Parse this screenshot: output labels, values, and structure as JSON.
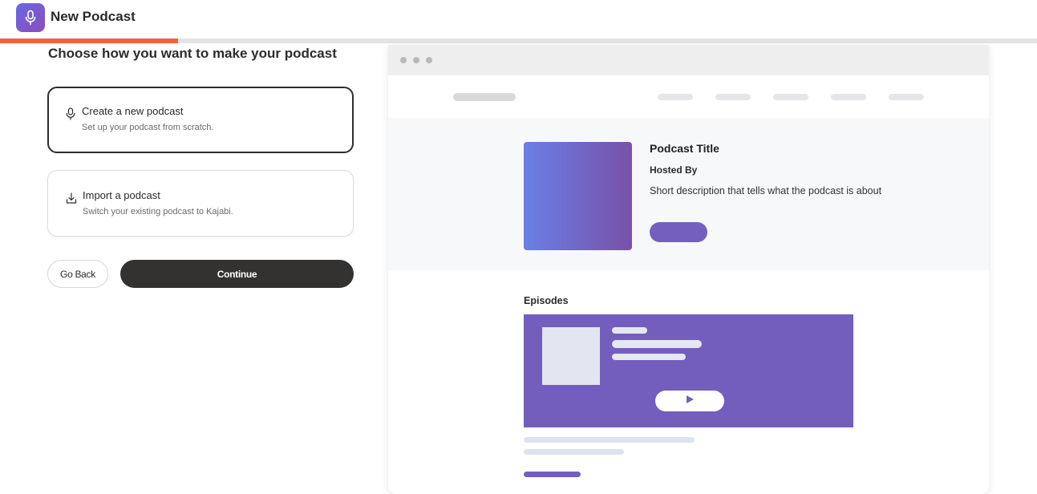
{
  "header": {
    "title": "New Podcast",
    "icon": "microphone-icon",
    "accent_gradient": [
      "#6a67e6",
      "#8a4fb8"
    ]
  },
  "progress": {
    "fraction": 0.172,
    "color": "#f0643c"
  },
  "chooser": {
    "heading": "Choose how you want to make your podcast",
    "options": [
      {
        "title": "Create a new podcast",
        "subtitle": "Set up your podcast from scratch.",
        "icon": "microphone-icon",
        "selected": true
      },
      {
        "title": "Import a podcast",
        "subtitle": "Switch your existing podcast to Kajabi.",
        "icon": "download-icon",
        "selected": false
      }
    ],
    "back_label": "Go Back",
    "continue_label": "Continue"
  },
  "preview": {
    "podcast_title": "Podcast Title",
    "hosted_by": "Hosted By",
    "description": "Short description that tells what the podcast is about",
    "episodes_label": "Episodes",
    "accent_color": "#735ebd"
  }
}
